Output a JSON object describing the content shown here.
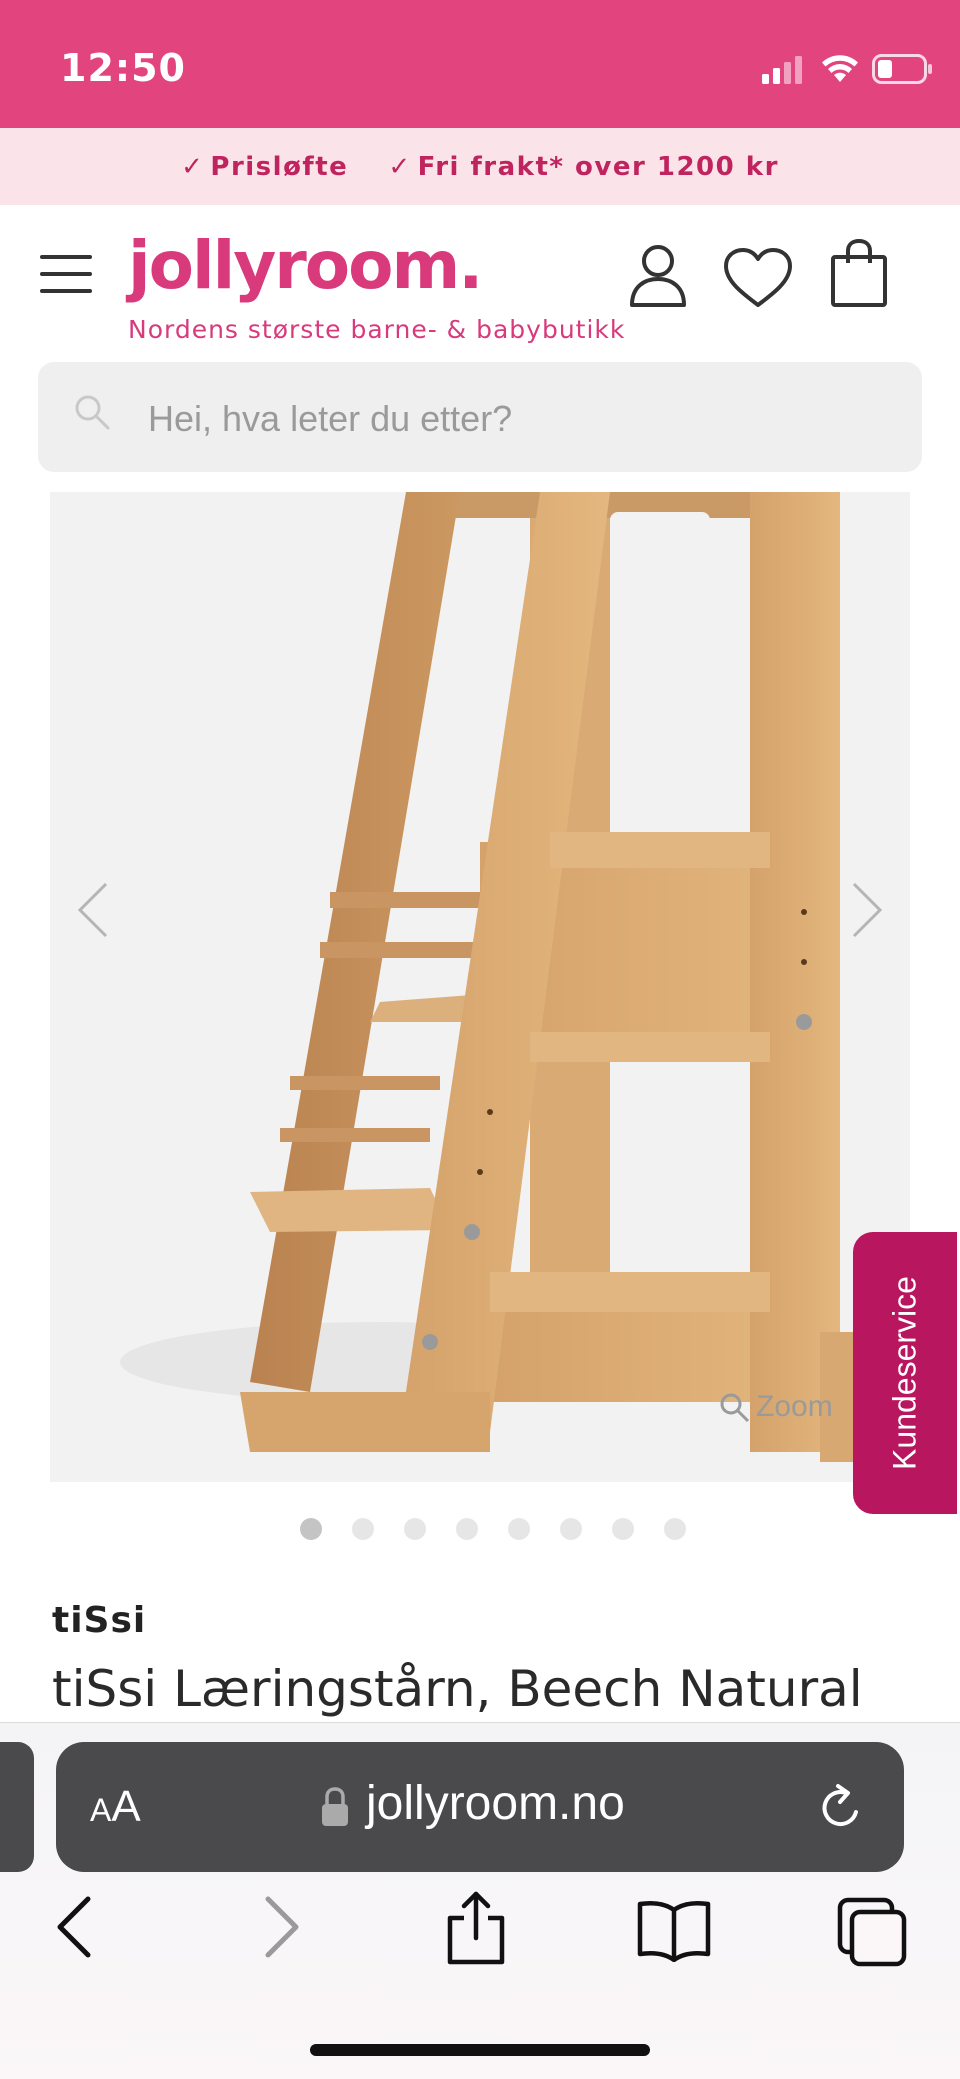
{
  "status_bar": {
    "time": "12:50"
  },
  "promo": {
    "items": [
      "Prisløfte",
      "Fri frakt* over 1200 kr"
    ]
  },
  "header": {
    "logo": "jollyroom.",
    "tagline": "Nordens største barne- & babybutikk"
  },
  "search": {
    "placeholder": "Hei, hva leter du etter?"
  },
  "gallery": {
    "zoom_label": "Zoom",
    "slide_count": 8,
    "active_slide": 1
  },
  "kundeservice": {
    "label": "Kundeservice"
  },
  "product": {
    "brand": "tiSsi",
    "title": "tiSsi Læringstårn, Beech Natural"
  },
  "browser": {
    "aa_small": "A",
    "aa_large": "A",
    "domain": "jollyroom.no"
  },
  "colors": {
    "brand_pink": "#e2447e",
    "logo_pink": "#d83a7c",
    "promo_bg": "#fbe3ea",
    "kundeservice_bg": "#b8165f"
  },
  "icons": [
    "signal-icon",
    "wifi-icon",
    "battery-icon",
    "check-icon",
    "hamburger-icon",
    "user-icon",
    "heart-icon",
    "bag-icon",
    "search-icon",
    "chevron-left-icon",
    "chevron-right-icon",
    "zoom-icon",
    "lock-icon",
    "reload-icon",
    "back-icon",
    "forward-icon",
    "share-icon",
    "bookmarks-icon",
    "tabs-icon"
  ]
}
